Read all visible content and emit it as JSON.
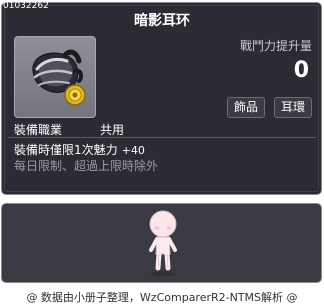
{
  "item": {
    "id": "01032262",
    "name": "暗影耳环",
    "icon": "shadow-earring-icon"
  },
  "stat": {
    "label": "戰鬥力提升量",
    "value": "0"
  },
  "tags": {
    "category": "飾品",
    "subcategory": "耳環"
  },
  "job": {
    "label": "裝備職業",
    "value": "共用"
  },
  "effect": {
    "text": "裝備時僅限1次魅力",
    "value": "+40"
  },
  "limit": {
    "text": "每日限制、超過上限時除外"
  },
  "preview": {
    "avatar": "character-avatar-icon"
  },
  "footer": {
    "credit": "@ 数据由小册子整理，WzComparerR2-NTMS解析 @"
  },
  "colors": {
    "panel_bg": "#2b2b33",
    "preview_bg": "#3a3a42",
    "border": "#8a8a96",
    "text_primary": "#ffffff",
    "text_muted": "#9b9ba3"
  }
}
